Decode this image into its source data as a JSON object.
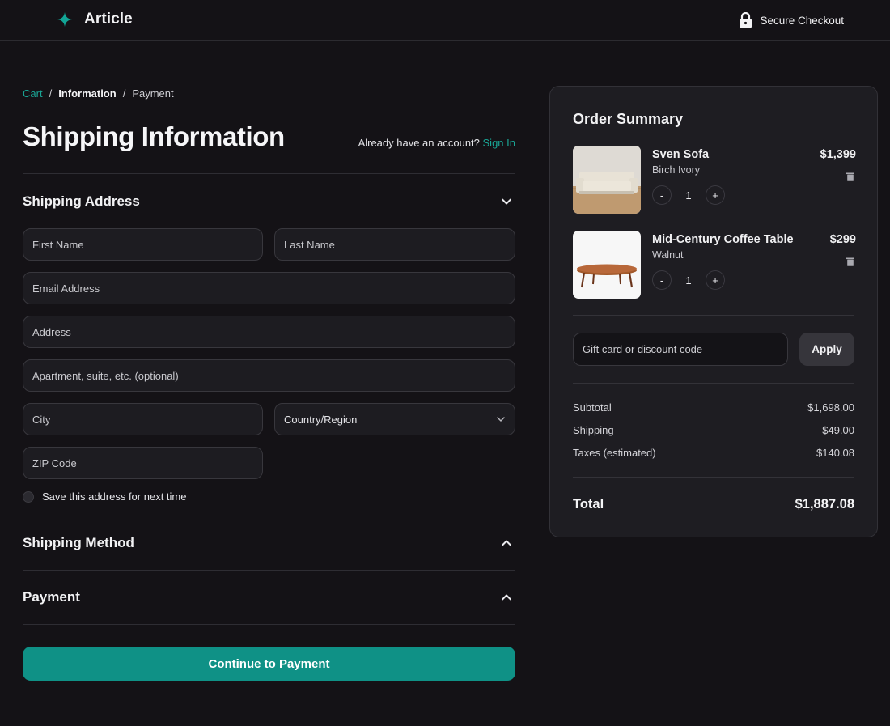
{
  "header": {
    "brand": "Article",
    "secure_label": "Secure Checkout"
  },
  "breadcrumb": {
    "cart": "Cart",
    "current": "Information",
    "next": "Payment",
    "separator": "/"
  },
  "page": {
    "title": "Shipping Information",
    "account_prompt": "Already have an account?",
    "signin": "Sign In"
  },
  "shipping_address": {
    "title": "Shipping Address",
    "first_name": "First Name",
    "last_name": "Last Name",
    "email": "Email Address",
    "address": "Address",
    "apartment": "Apartment, suite, etc. (optional)",
    "city": "City",
    "country": "Country/Region",
    "zip": "ZIP Code",
    "save_label": "Save this address for next time"
  },
  "sections": {
    "shipping_method": "Shipping Method",
    "payment": "Payment"
  },
  "cta": "Continue to Payment",
  "summary": {
    "title": "Order Summary",
    "items": [
      {
        "name": "Sven Sofa",
        "variant": "Birch Ivory",
        "price": "$1,399",
        "qty": "1"
      },
      {
        "name": "Mid-Century Coffee Table",
        "variant": "Walnut",
        "price": "$299",
        "qty": "1"
      }
    ],
    "qty_minus": "-",
    "qty_plus": "+",
    "code_placeholder": "Gift card or discount code",
    "apply": "Apply",
    "subtotal_label": "Subtotal",
    "subtotal": "$1,698.00",
    "shipping_label": "Shipping",
    "shipping": "$49.00",
    "taxes_label": "Taxes (estimated)",
    "taxes": "$140.08",
    "total_label": "Total",
    "total": "$1,887.08"
  },
  "colors": {
    "background": "#141216",
    "accent": "#0f9186",
    "link": "#1aa595",
    "panel": "#1e1d22"
  }
}
